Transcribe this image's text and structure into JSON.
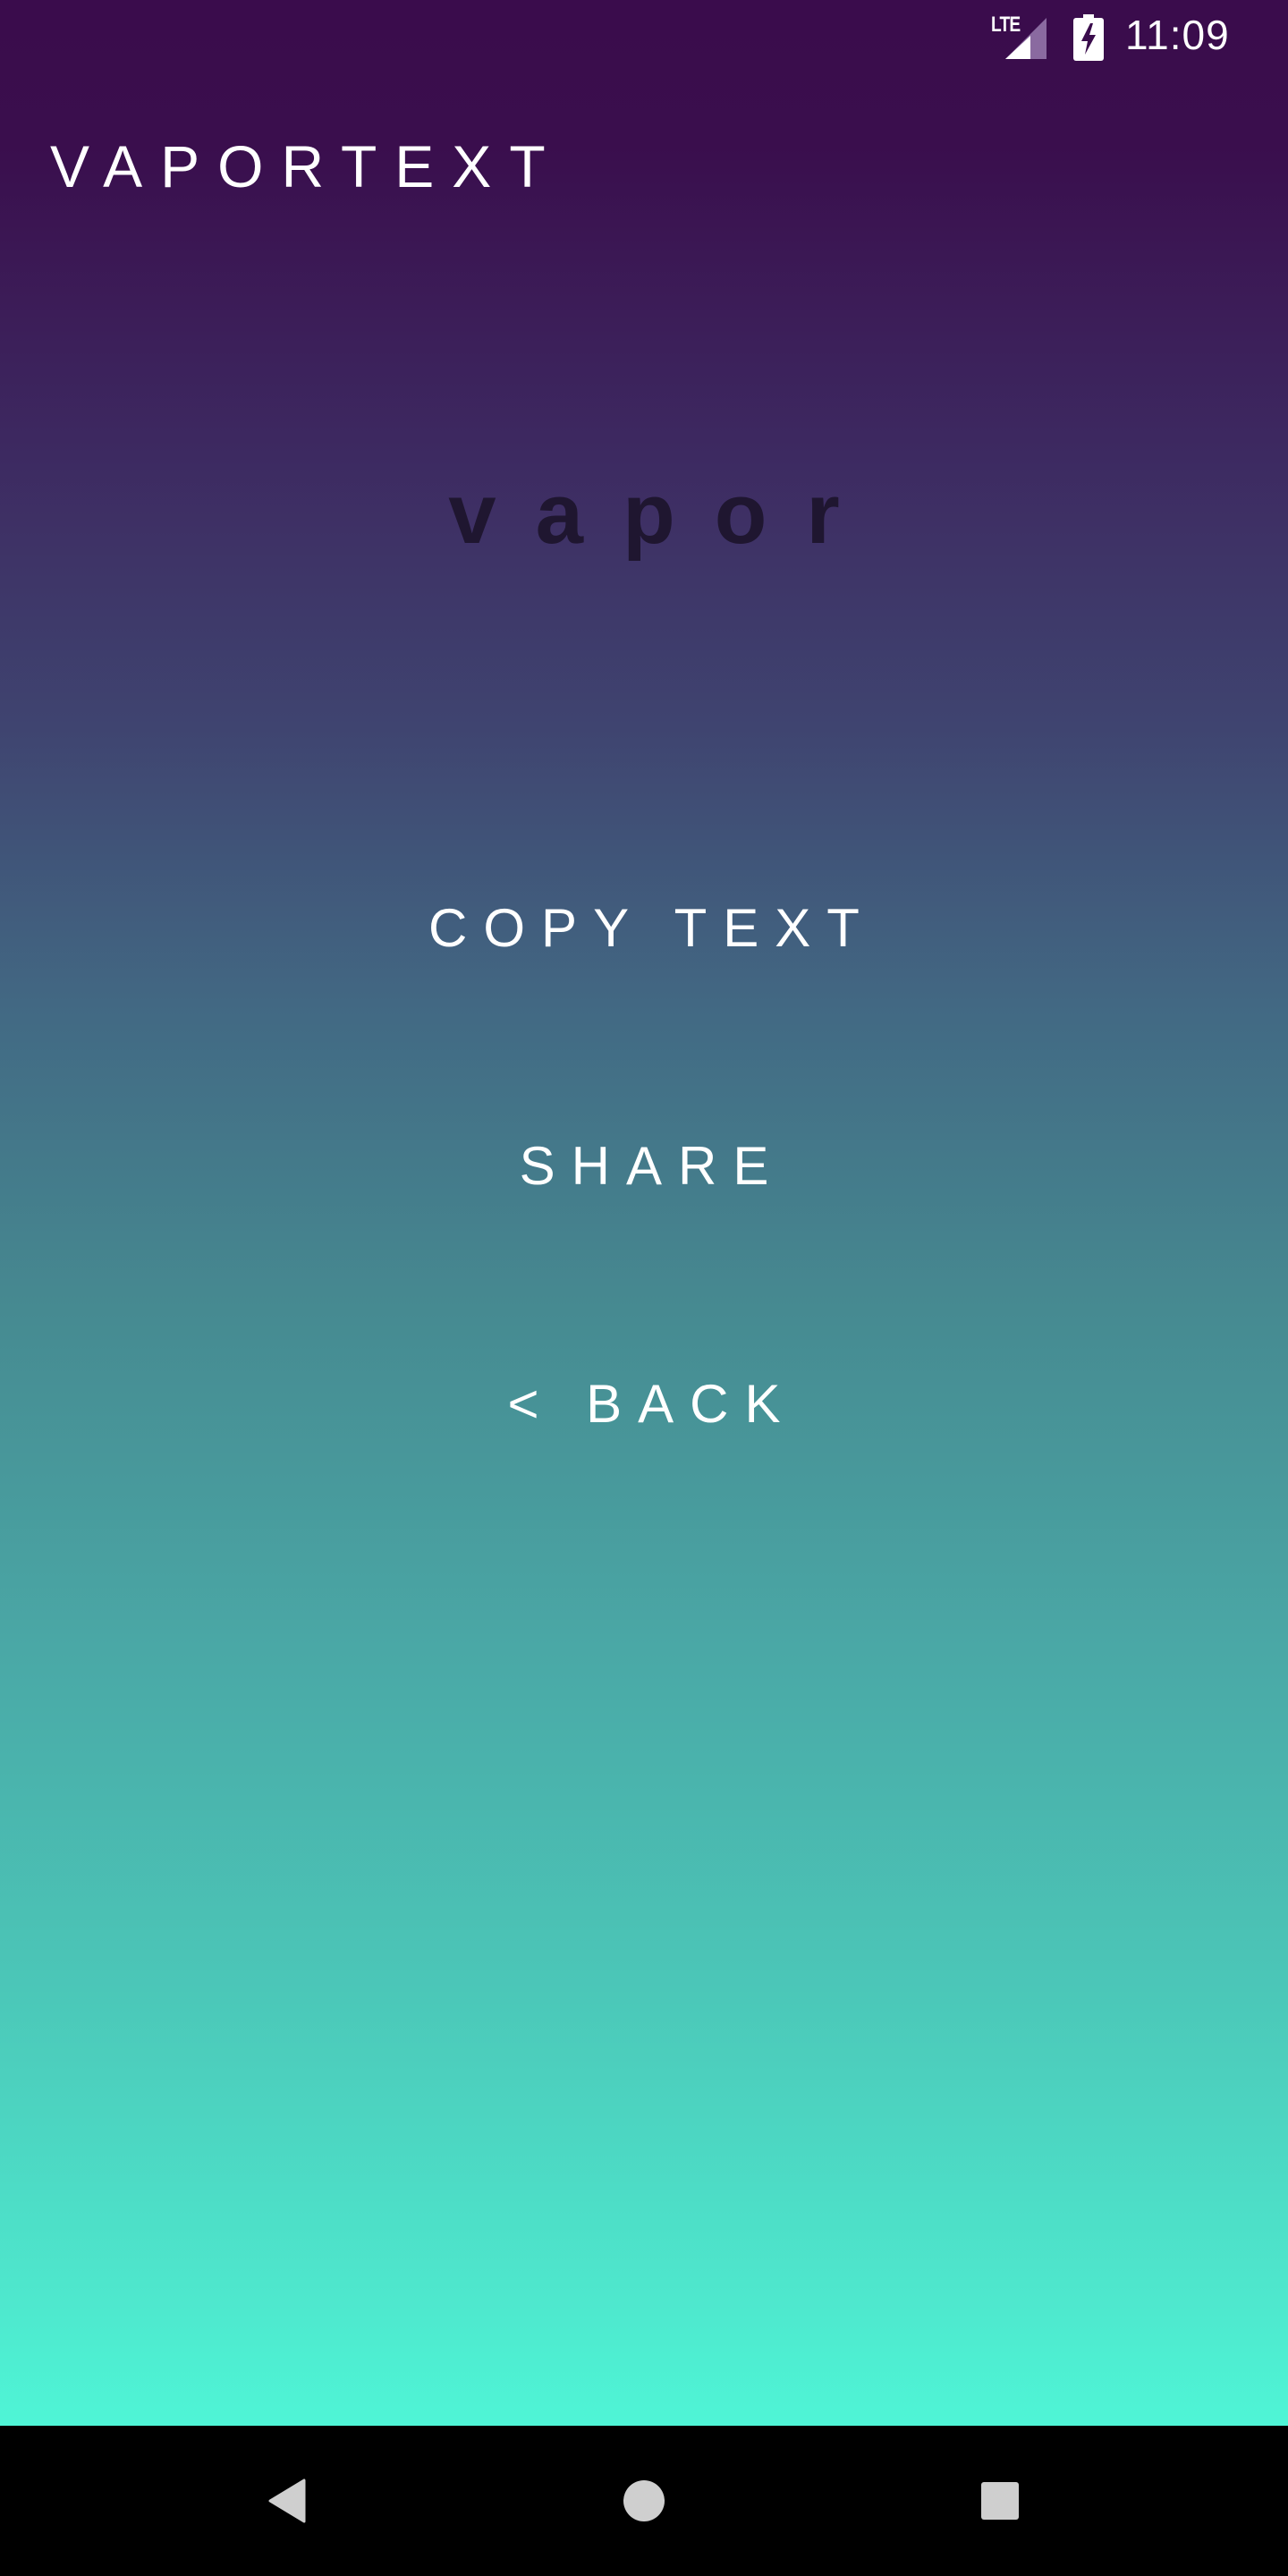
{
  "status_bar": {
    "network_label": "LTE",
    "signal_icon": "signal-icon",
    "battery_icon": "battery-charging-icon",
    "time": "11:09"
  },
  "app": {
    "title": "VAPORTEXT",
    "preview_text": "vapor"
  },
  "actions": {
    "copy_label": "COPY TEXT",
    "share_label": "SHARE",
    "back_label": "< BACK"
  },
  "nav_bar": {
    "back_icon": "triangle-back-icon",
    "home_icon": "circle-home-icon",
    "recents_icon": "square-recents-icon"
  },
  "colors": {
    "gradient_top": "#3a0c4c",
    "gradient_bottom": "#4ff5d6",
    "preview_text_color": "#1f1630",
    "label_color": "#ffffff"
  }
}
